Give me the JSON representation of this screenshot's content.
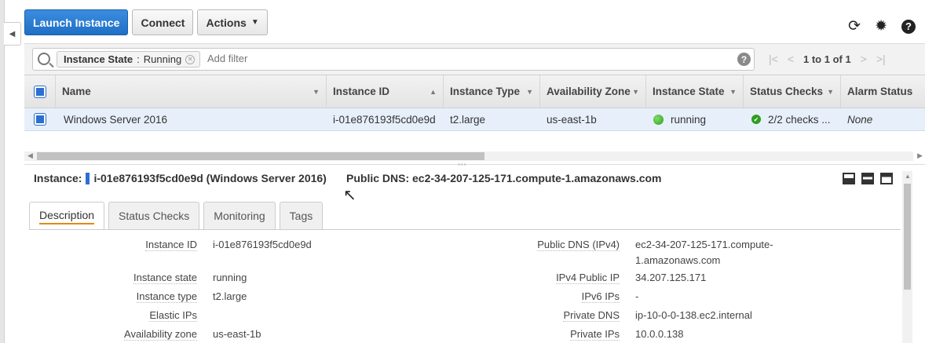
{
  "toolbar": {
    "launch_label": "Launch Instance",
    "connect_label": "Connect",
    "actions_label": "Actions"
  },
  "filter": {
    "chip_key": "Instance State",
    "chip_sep": ":",
    "chip_value": "Running",
    "placeholder": "Add filter"
  },
  "pager": {
    "text": "1 to 1 of 1"
  },
  "table": {
    "columns": [
      "Name",
      "Instance ID",
      "Instance Type",
      "Availability Zone",
      "Instance State",
      "Status Checks",
      "Alarm Status"
    ],
    "row": {
      "name": "Windows Server 2016",
      "instance_id": "i-01e876193f5cd0e9d",
      "instance_type": "t2.large",
      "az": "us-east-1b",
      "state": "running",
      "status_checks": "2/2 checks ...",
      "alarm": "None"
    }
  },
  "detail": {
    "instance_label": "Instance:",
    "instance_value": "i-01e876193f5cd0e9d (Windows Server 2016)",
    "public_dns_label": "Public DNS:",
    "public_dns_value": "ec2-34-207-125-171.compute-1.amazonaws.com",
    "tabs": [
      "Description",
      "Status Checks",
      "Monitoring",
      "Tags"
    ],
    "left_fields": [
      {
        "k": "Instance ID",
        "v": "i-01e876193f5cd0e9d"
      },
      {
        "k": "Instance state",
        "v": "running"
      },
      {
        "k": "Instance type",
        "v": "t2.large"
      },
      {
        "k": "Elastic IPs",
        "v": ""
      },
      {
        "k": "Availability zone",
        "v": "us-east-1b"
      }
    ],
    "right_fields": [
      {
        "k": "Public DNS (IPv4)",
        "v": "ec2-34-207-125-171.compute-",
        "v2": "1.amazonaws.com"
      },
      {
        "k": "IPv4 Public IP",
        "v": "34.207.125.171"
      },
      {
        "k": "IPv6 IPs",
        "v": "-"
      },
      {
        "k": "Private DNS",
        "v": "ip-10-0-0-138.ec2.internal"
      },
      {
        "k": "Private IPs",
        "v": "10.0.0.138"
      }
    ]
  },
  "icons": {
    "refresh": "refresh-icon",
    "settings": "gear-icon",
    "help": "help-icon"
  },
  "colors": {
    "primary": "#1f6fc5",
    "selected_row": "#e7f0fa",
    "running": "#2e9e1f",
    "tab_underline": "#e28a12"
  }
}
